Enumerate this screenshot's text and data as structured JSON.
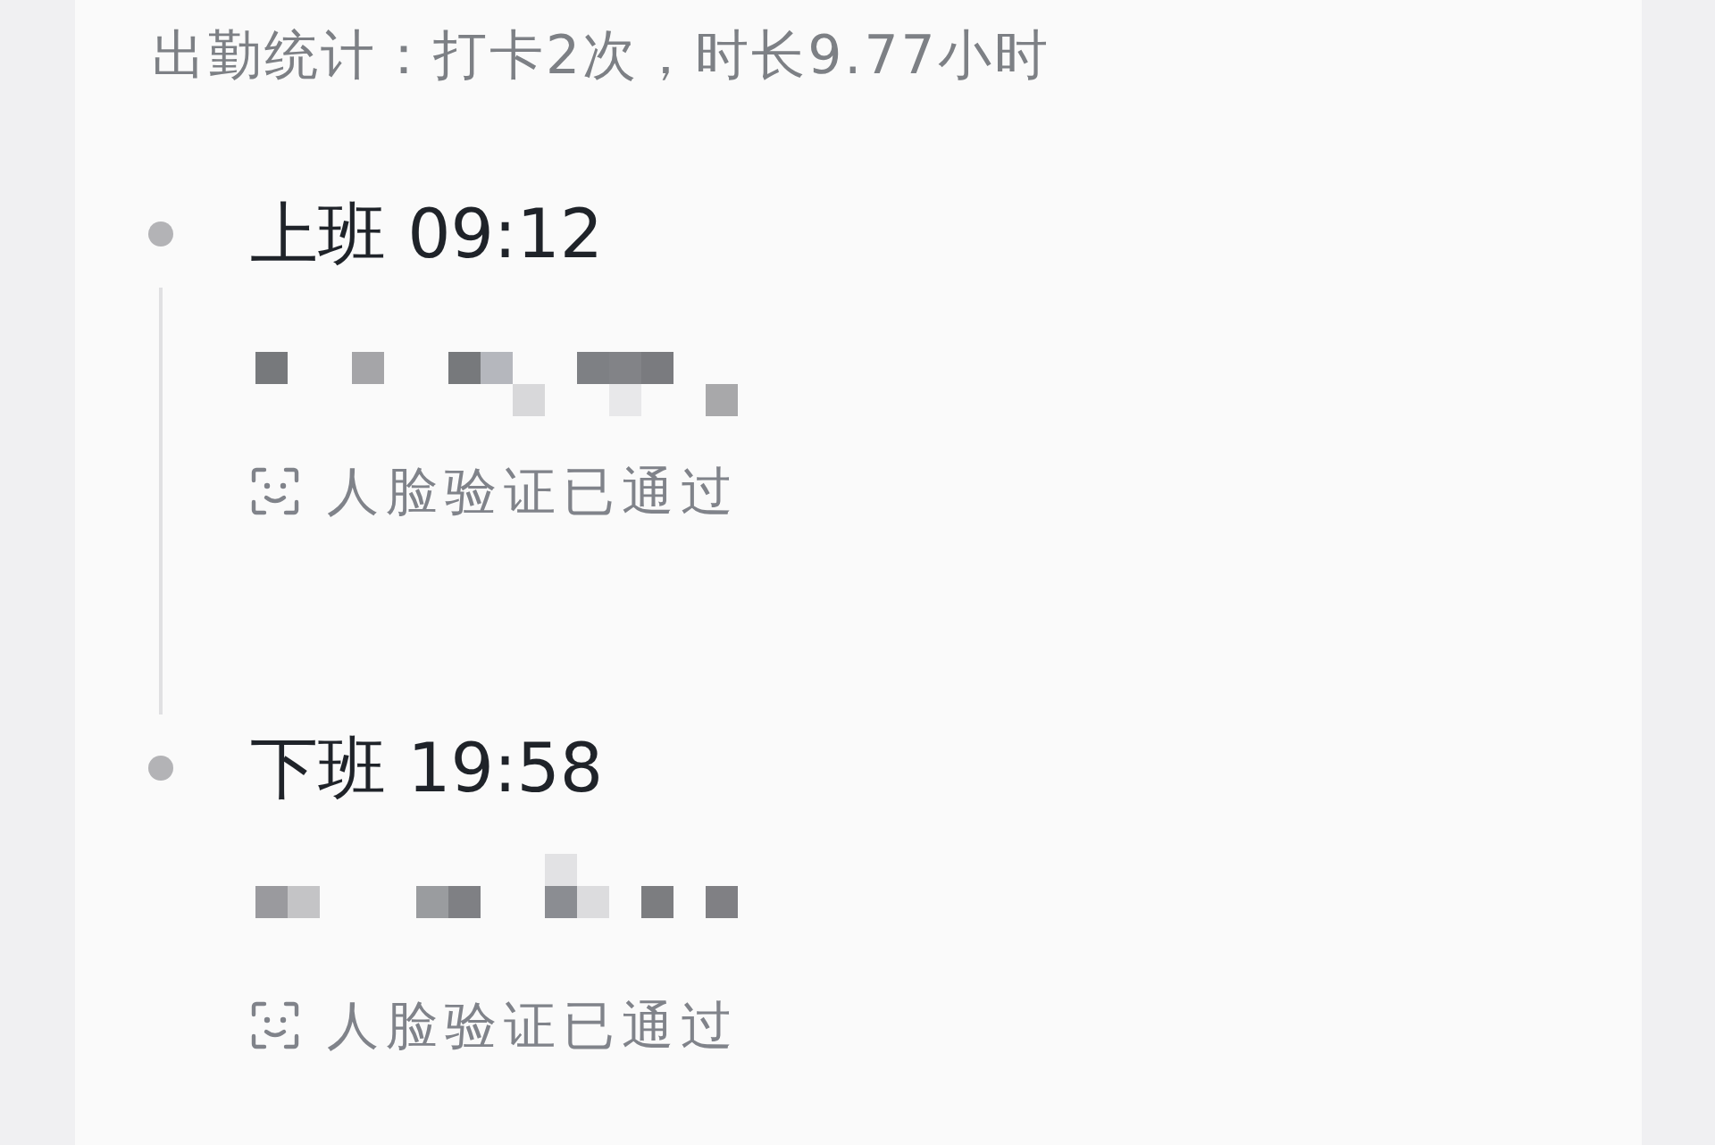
{
  "summary": "出勤统计：打卡2次，时长9.77小时",
  "records": [
    {
      "title": "上班 09:12",
      "location_redacted": true,
      "verification": "人脸验证已通过"
    },
    {
      "title": "下班 19:58",
      "location_redacted": true,
      "verification": "人脸验证已通过"
    }
  ]
}
